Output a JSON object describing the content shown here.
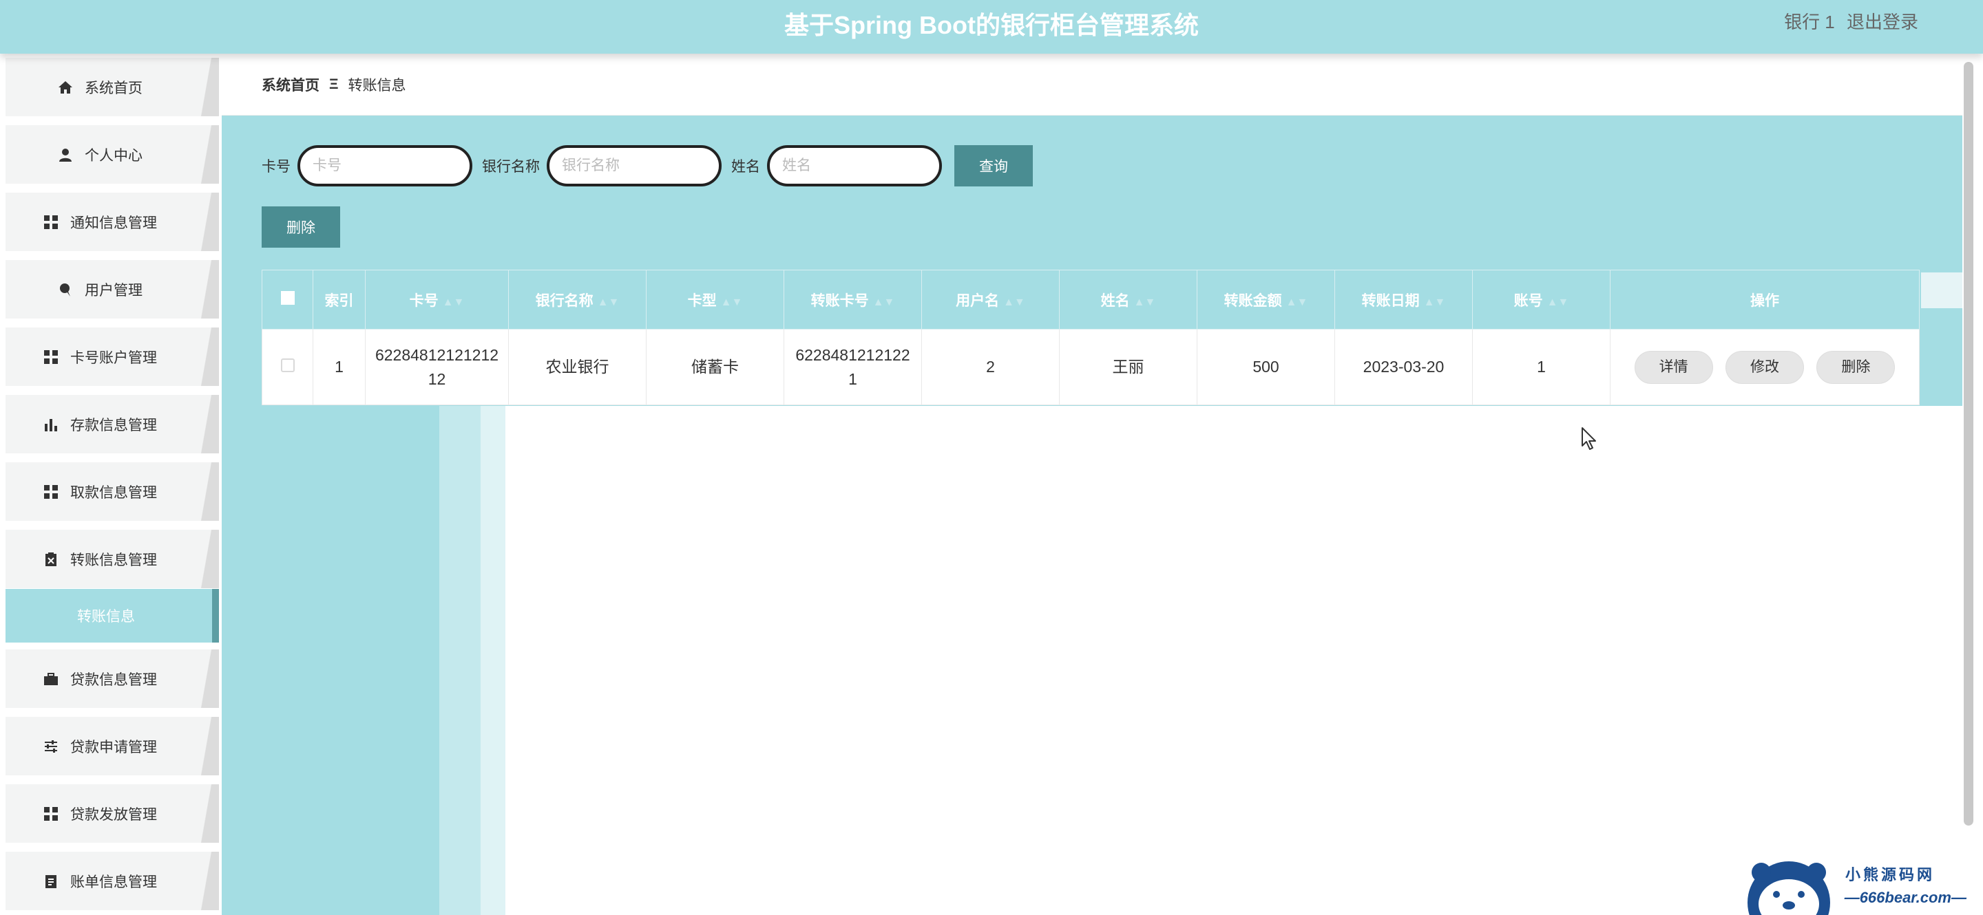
{
  "header": {
    "title": "基于Spring Boot的银行柜台管理系统",
    "user": "银行 1",
    "logout": "退出登录"
  },
  "sidebar": {
    "items": [
      {
        "label": "系统首页",
        "icon": "home-icon"
      },
      {
        "label": "个人中心",
        "icon": "user-icon"
      },
      {
        "label": "通知信息管理",
        "icon": "grid-icon"
      },
      {
        "label": "用户管理",
        "icon": "pin-icon"
      },
      {
        "label": "卡号账户管理",
        "icon": "grid-icon"
      },
      {
        "label": "存款信息管理",
        "icon": "bar-chart-icon"
      },
      {
        "label": "取款信息管理",
        "icon": "grid-icon"
      },
      {
        "label": "转账信息管理",
        "icon": "clipboard-icon"
      },
      {
        "label": "贷款信息管理",
        "icon": "briefcase-icon"
      },
      {
        "label": "贷款申请管理",
        "icon": "sliders-icon"
      },
      {
        "label": "贷款发放管理",
        "icon": "grid-icon"
      },
      {
        "label": "账单信息管理",
        "icon": "document-icon"
      }
    ],
    "active_sub": "转账信息"
  },
  "breadcrumb": {
    "home": "系统首页",
    "separator": "Ξ",
    "current": "转账信息"
  },
  "search": {
    "card_label": "卡号",
    "card_placeholder": "卡号",
    "bank_label": "银行名称",
    "bank_placeholder": "银行名称",
    "name_label": "姓名",
    "name_placeholder": "姓名",
    "query_button": "查询"
  },
  "actions": {
    "delete_button": "删除"
  },
  "table": {
    "headers": [
      "索引",
      "卡号",
      "银行名称",
      "卡型",
      "转账卡号",
      "用户名",
      "姓名",
      "转账金额",
      "转账日期",
      "账号",
      "操作"
    ],
    "rows": [
      {
        "index": "1",
        "card_no": "6228481212121212",
        "bank": "农业银行",
        "card_type": "储蓄卡",
        "transfer_card_no": "6228481212122 1",
        "username": "2",
        "name": "王丽",
        "amount": "500",
        "date": "2023-03-20",
        "account": "1",
        "ops": [
          "详情",
          "修改",
          "删除"
        ]
      }
    ]
  },
  "watermark": {
    "title": "小熊源码网",
    "url": "—666bear.com—"
  },
  "colors": {
    "accent": "#a4dde3",
    "button": "#4a8d92"
  }
}
